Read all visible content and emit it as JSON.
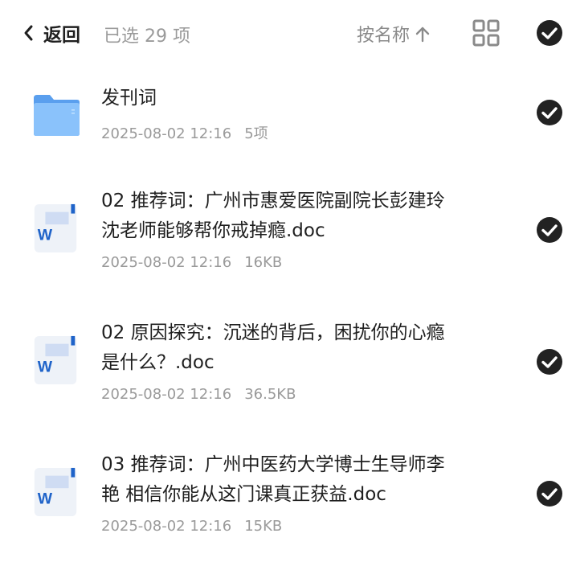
{
  "header": {
    "back_label": "返回",
    "selected_text": "已选 29 项",
    "sort_label": "按名称",
    "icons": [
      "chevron-left-icon",
      "arrow-up-icon",
      "grid-view-icon",
      "check-circle-icon"
    ]
  },
  "colors": {
    "check": "#222222",
    "folder": "#6aaef5",
    "word_blue": "#1f63c9",
    "muted": "#9a9a9a"
  },
  "files": [
    {
      "type": "folder",
      "icon": "folder-icon",
      "name": "发刊词",
      "date": "2025-08-02 12:16",
      "size": "5项",
      "selected": true
    },
    {
      "type": "doc",
      "icon": "word-doc-icon",
      "name": "02 推荐词：广州市惠爱医院副院长彭建玲\n沈老师能够帮你戒掉瘾.doc",
      "date": "2025-08-02 12:16",
      "size": "16KB",
      "selected": true
    },
    {
      "type": "doc",
      "icon": "word-doc-icon",
      "name": "02 原因探究：沉迷的背后，困扰你的心瘾\n是什么？.doc",
      "date": "2025-08-02 12:16",
      "size": "36.5KB",
      "selected": true
    },
    {
      "type": "doc",
      "icon": "word-doc-icon",
      "name": "03 推荐词：广州中医药大学博士生导师李\n艳 相信你能从这门课真正获益.doc",
      "date": "2025-08-02 12:16",
      "size": "15KB",
      "selected": true
    }
  ]
}
